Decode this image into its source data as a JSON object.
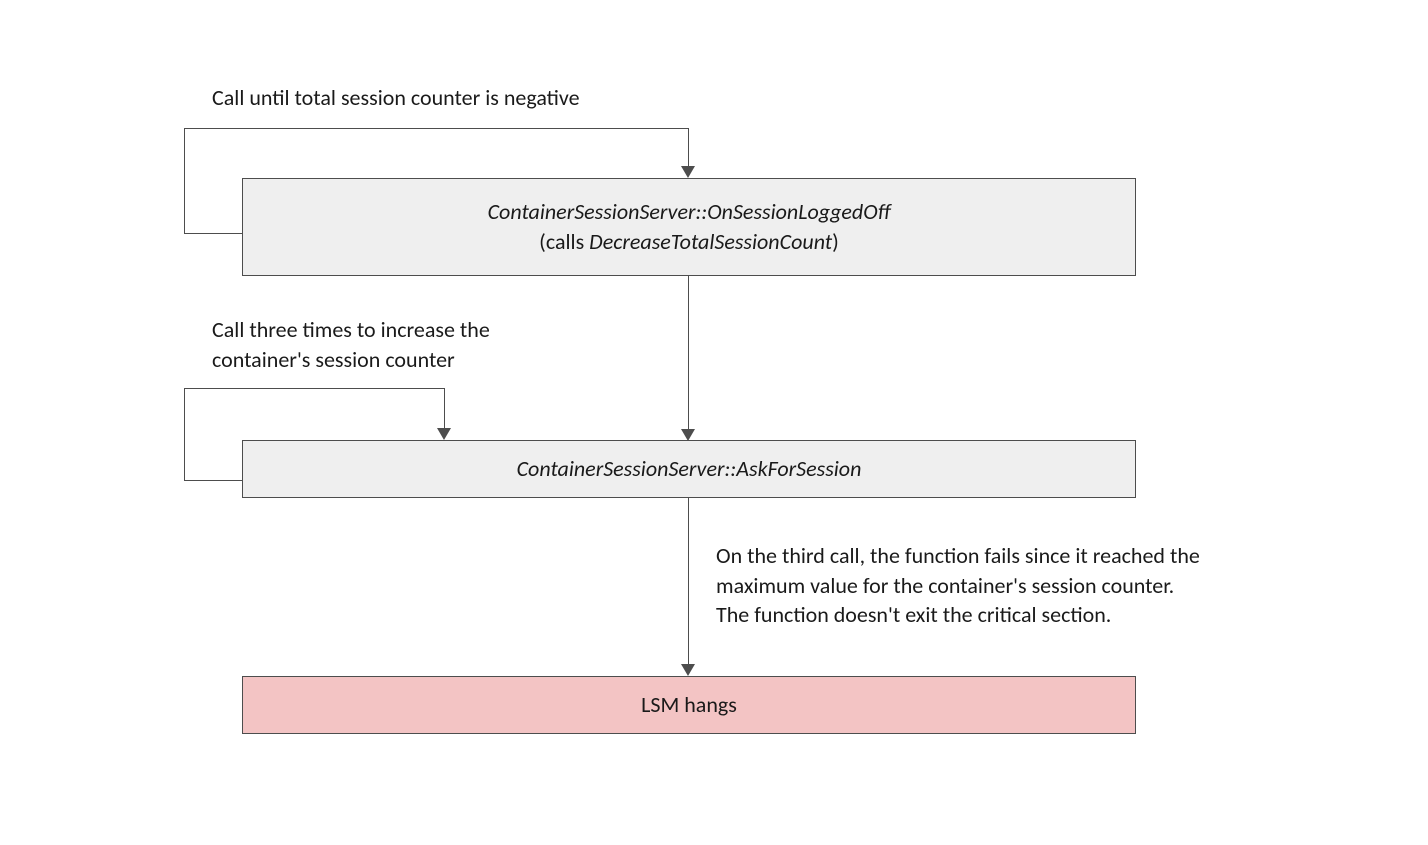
{
  "labels": {
    "top_note": "Call until total session counter is negative",
    "middle_note_line1": "Call three times to increase the",
    "middle_note_line2": "container's session counter",
    "bottom_note_line1": "On the third call, the function fails since it reached the",
    "bottom_note_line2": "maximum value for the container's session counter.",
    "bottom_note_line3": "The function doesn't exit the critical section."
  },
  "boxes": {
    "box1_line1": "ContainerSessionServer::OnSessionLoggedOff",
    "box1_line2_prefix": "(calls ",
    "box1_line2_italic": "DecreaseTotalSessionCount",
    "box1_line2_suffix": ")",
    "box2": "ContainerSessionServer::AskForSession",
    "box3": "LSM hangs"
  }
}
